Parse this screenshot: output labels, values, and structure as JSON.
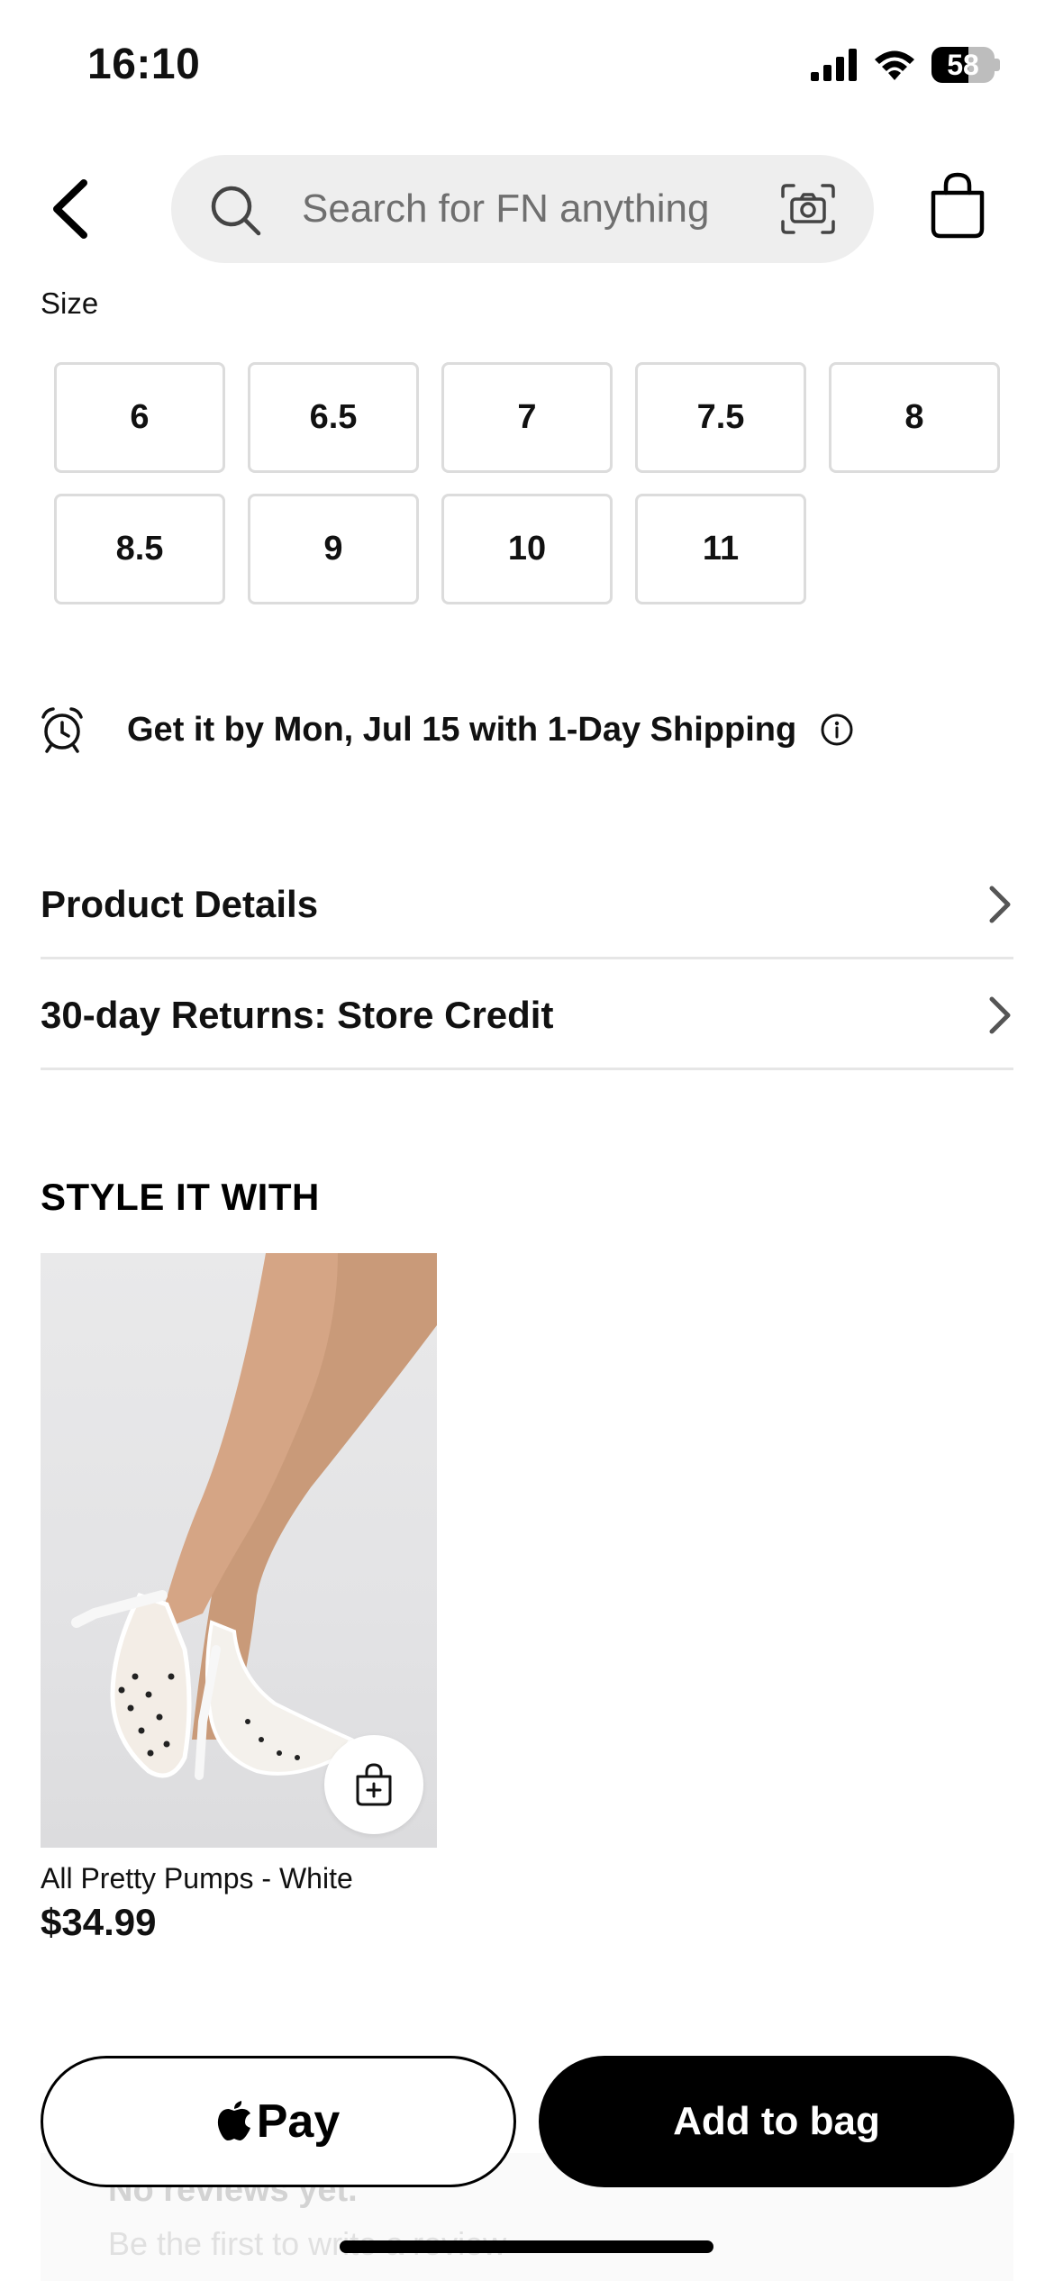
{
  "status_bar": {
    "time": "16:10",
    "battery": "58",
    "battery_level": 0.58
  },
  "header": {
    "search_placeholder": "Search for FN anything"
  },
  "size": {
    "label": "Size",
    "options": [
      "6",
      "6.5",
      "7",
      "7.5",
      "8",
      "8.5",
      "9",
      "10",
      "11"
    ]
  },
  "shipping": {
    "text": "Get it by Mon, Jul 15 with 1-Day Shipping"
  },
  "accordion": {
    "product_details": "Product Details",
    "returns": "30-day Returns: Store Credit"
  },
  "style_it_with": {
    "title": "STYLE IT WITH",
    "product": {
      "name": "All Pretty Pumps - White",
      "price": "$34.99"
    }
  },
  "reviews": {
    "title": "No reviews yet.",
    "subtitle": "Be the first to write a review"
  },
  "actions": {
    "apple_pay": "Pay",
    "add_to_bag": "Add to bag"
  }
}
